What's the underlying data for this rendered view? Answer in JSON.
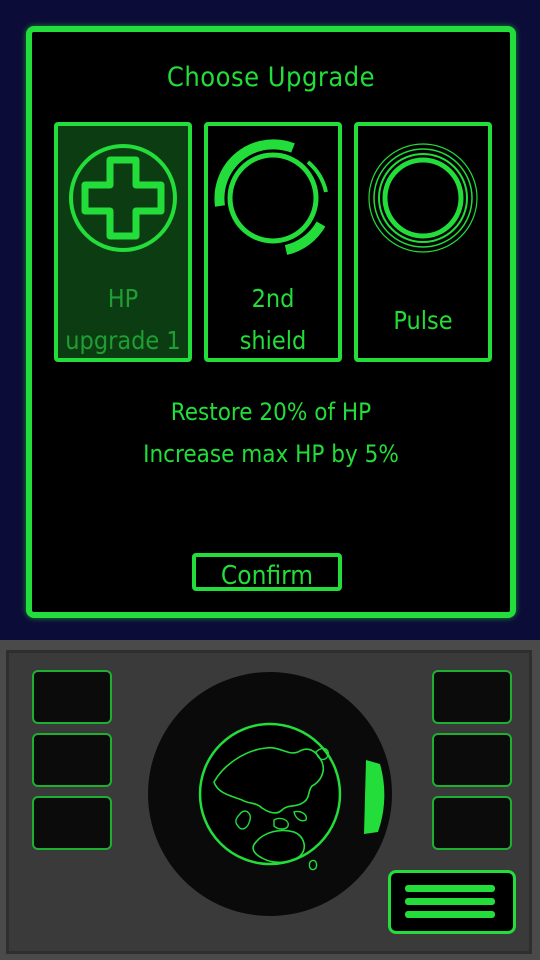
{
  "dialog": {
    "title": "Choose Upgrade",
    "options": [
      {
        "label_line1": "HP",
        "label_line2": "upgrade 1",
        "icon": "medical-cross-icon",
        "selected": true
      },
      {
        "label_line1": "2nd",
        "label_line2": "shield",
        "icon": "shield-ring-icon",
        "selected": false
      },
      {
        "label": "Pulse",
        "icon": "pulse-rings-icon",
        "selected": false
      }
    ],
    "description": {
      "line1": "Restore 20% of HP",
      "line2": "Increase max HP by 5%"
    },
    "confirm_label": "Confirm"
  },
  "console": {
    "radar_icon": "earth-globe-icon",
    "menu_icon": "hamburger-menu-icon"
  },
  "colors": {
    "accent": "#22dd3a",
    "selected_fill": "#0c3d12",
    "outer_bg": "#0c0c38",
    "console_bg": "#3a3a3a"
  }
}
